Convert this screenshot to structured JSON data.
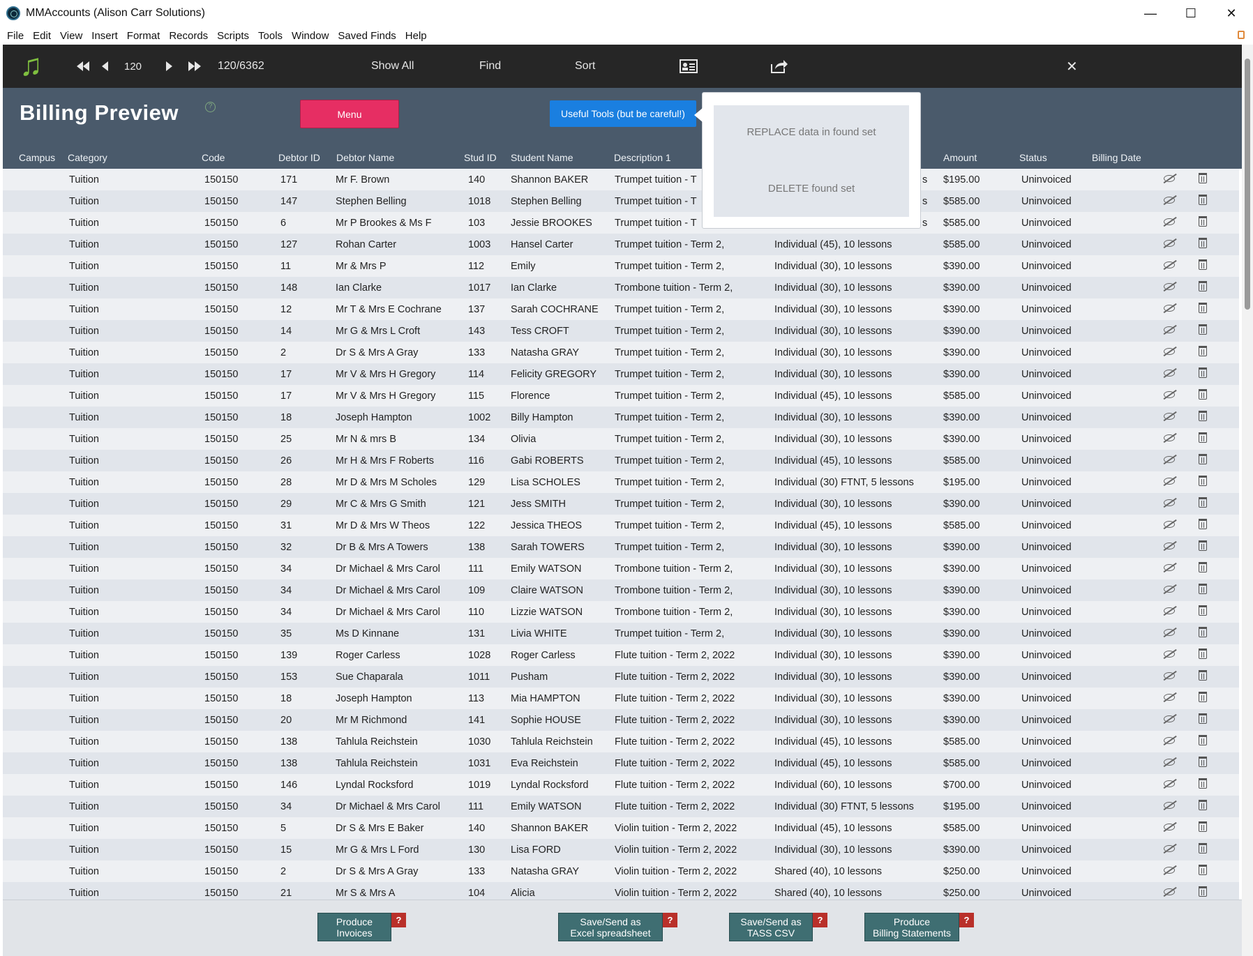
{
  "window": {
    "title": "MMAccounts (Alison Carr Solutions)",
    "minimize": "—",
    "maximize": "☐",
    "close": "✕"
  },
  "menu": [
    "File",
    "Edit",
    "View",
    "Insert",
    "Format",
    "Records",
    "Scripts",
    "Tools",
    "Window",
    "Saved Finds",
    "Help"
  ],
  "toolbar": {
    "record_number": "120",
    "record_count": "120/6362",
    "show_all": "Show All",
    "find": "Find",
    "sort": "Sort"
  },
  "header": {
    "title": "Billing Preview",
    "help": "?",
    "menu_button": "Menu",
    "tools_button": "Useful Tools (but be careful!)",
    "columns": [
      "Campus",
      "Category",
      "Code",
      "Debtor ID",
      "Debtor Name",
      "Stud ID",
      "Student Name",
      "Description 1",
      "Amount",
      "Status",
      "Billing Date"
    ]
  },
  "popover": {
    "replace": "REPLACE data in found set",
    "delete": "DELETE found set"
  },
  "rows": [
    {
      "category": "Tuition",
      "code": "150150",
      "debtor_id": "171",
      "debtor": "Mr F. Brown",
      "stud_id": "140",
      "student": "Shannon BAKER",
      "desc1": "Trumpet tuition - T",
      "desc2": "",
      "amount": "$195.00",
      "status": "Uninvoiced"
    },
    {
      "category": "Tuition",
      "code": "150150",
      "debtor_id": "147",
      "debtor": "Stephen Belling",
      "stud_id": "1018",
      "student": "Stephen Belling",
      "desc1": "Trumpet tuition - T",
      "desc2": "",
      "amount": "$585.00",
      "status": "Uninvoiced"
    },
    {
      "category": "Tuition",
      "code": "150150",
      "debtor_id": "6",
      "debtor": "Mr P Brookes & Ms F",
      "stud_id": "103",
      "student": "Jessie BROOKES",
      "desc1": "Trumpet tuition - T",
      "desc2": "",
      "amount": "$585.00",
      "status": "Uninvoiced"
    },
    {
      "category": "Tuition",
      "code": "150150",
      "debtor_id": "127",
      "debtor": "Rohan Carter",
      "stud_id": "1003",
      "student": "Hansel Carter",
      "desc1": "Trumpet tuition - Term 2,",
      "desc2": "Individual (45), 10 lessons",
      "amount": "$585.00",
      "status": "Uninvoiced"
    },
    {
      "category": "Tuition",
      "code": "150150",
      "debtor_id": "11",
      "debtor": "Mr & Mrs P",
      "stud_id": "112",
      "student": "Emily",
      "desc1": "Trumpet tuition - Term 2,",
      "desc2": "Individual (30), 10 lessons",
      "amount": "$390.00",
      "status": "Uninvoiced"
    },
    {
      "category": "Tuition",
      "code": "150150",
      "debtor_id": "148",
      "debtor": "Ian Clarke",
      "stud_id": "1017",
      "student": "Ian Clarke",
      "desc1": "Trombone tuition - Term 2,",
      "desc2": "Individual (30), 10 lessons",
      "amount": "$390.00",
      "status": "Uninvoiced"
    },
    {
      "category": "Tuition",
      "code": "150150",
      "debtor_id": "12",
      "debtor": "Mr T & Mrs E Cochrane",
      "stud_id": "137",
      "student": "Sarah COCHRANE",
      "desc1": "Trumpet tuition - Term 2,",
      "desc2": "Individual (30), 10 lessons",
      "amount": "$390.00",
      "status": "Uninvoiced"
    },
    {
      "category": "Tuition",
      "code": "150150",
      "debtor_id": "14",
      "debtor": "Mr G & Mrs L Croft",
      "stud_id": "143",
      "student": "Tess CROFT",
      "desc1": "Trumpet tuition - Term 2,",
      "desc2": "Individual (30), 10 lessons",
      "amount": "$390.00",
      "status": "Uninvoiced"
    },
    {
      "category": "Tuition",
      "code": "150150",
      "debtor_id": "2",
      "debtor": "Dr S & Mrs A Gray",
      "stud_id": "133",
      "student": "Natasha GRAY",
      "desc1": "Trumpet tuition - Term 2,",
      "desc2": "Individual (30), 10 lessons",
      "amount": "$390.00",
      "status": "Uninvoiced"
    },
    {
      "category": "Tuition",
      "code": "150150",
      "debtor_id": "17",
      "debtor": "Mr V & Mrs H Gregory",
      "stud_id": "114",
      "student": "Felicity GREGORY",
      "desc1": "Trumpet tuition - Term 2,",
      "desc2": "Individual (30), 10 lessons",
      "amount": "$390.00",
      "status": "Uninvoiced"
    },
    {
      "category": "Tuition",
      "code": "150150",
      "debtor_id": "17",
      "debtor": "Mr V & Mrs H Gregory",
      "stud_id": "115",
      "student": "Florence",
      "desc1": "Trumpet tuition - Term 2,",
      "desc2": "Individual (45), 10 lessons",
      "amount": "$585.00",
      "status": "Uninvoiced"
    },
    {
      "category": "Tuition",
      "code": "150150",
      "debtor_id": "18",
      "debtor": "Joseph Hampton",
      "stud_id": "1002",
      "student": "Billy Hampton",
      "desc1": "Trumpet tuition - Term 2,",
      "desc2": "Individual (30), 10 lessons",
      "amount": "$390.00",
      "status": "Uninvoiced"
    },
    {
      "category": "Tuition",
      "code": "150150",
      "debtor_id": "25",
      "debtor": "Mr N & mrs B",
      "stud_id": "134",
      "student": "Olivia",
      "desc1": "Trumpet tuition - Term 2,",
      "desc2": "Individual (30), 10 lessons",
      "amount": "$390.00",
      "status": "Uninvoiced"
    },
    {
      "category": "Tuition",
      "code": "150150",
      "debtor_id": "26",
      "debtor": "Mr H & Mrs F Roberts",
      "stud_id": "116",
      "student": "Gabi ROBERTS",
      "desc1": "Trumpet tuition - Term 2,",
      "desc2": "Individual (45), 10 lessons",
      "amount": "$585.00",
      "status": "Uninvoiced"
    },
    {
      "category": "Tuition",
      "code": "150150",
      "debtor_id": "28",
      "debtor": "Mr D & Mrs M Scholes",
      "stud_id": "129",
      "student": "Lisa SCHOLES",
      "desc1": "Trumpet tuition - Term 2,",
      "desc2": "Individual (30) FTNT, 5 lessons",
      "amount": "$195.00",
      "status": "Uninvoiced"
    },
    {
      "category": "Tuition",
      "code": "150150",
      "debtor_id": "29",
      "debtor": "Mr C & Mrs G Smith",
      "stud_id": "121",
      "student": "Jess SMITH",
      "desc1": "Trumpet tuition - Term 2,",
      "desc2": "Individual (30), 10 lessons",
      "amount": "$390.00",
      "status": "Uninvoiced"
    },
    {
      "category": "Tuition",
      "code": "150150",
      "debtor_id": "31",
      "debtor": "Mr D & Mrs W Theos",
      "stud_id": "122",
      "student": "Jessica THEOS",
      "desc1": "Trumpet tuition - Term 2,",
      "desc2": "Individual (45), 10 lessons",
      "amount": "$585.00",
      "status": "Uninvoiced"
    },
    {
      "category": "Tuition",
      "code": "150150",
      "debtor_id": "32",
      "debtor": "Dr B & Mrs A Towers",
      "stud_id": "138",
      "student": "Sarah TOWERS",
      "desc1": "Trumpet tuition - Term 2,",
      "desc2": "Individual (30), 10 lessons",
      "amount": "$390.00",
      "status": "Uninvoiced"
    },
    {
      "category": "Tuition",
      "code": "150150",
      "debtor_id": "34",
      "debtor": "Dr Michael & Mrs Carol",
      "stud_id": "111",
      "student": "Emily WATSON",
      "desc1": "Trombone tuition - Term 2,",
      "desc2": "Individual (30), 10 lessons",
      "amount": "$390.00",
      "status": "Uninvoiced"
    },
    {
      "category": "Tuition",
      "code": "150150",
      "debtor_id": "34",
      "debtor": "Dr Michael & Mrs Carol",
      "stud_id": "109",
      "student": "Claire WATSON",
      "desc1": "Trombone tuition - Term 2,",
      "desc2": "Individual (30), 10 lessons",
      "amount": "$390.00",
      "status": "Uninvoiced"
    },
    {
      "category": "Tuition",
      "code": "150150",
      "debtor_id": "34",
      "debtor": "Dr Michael & Mrs Carol",
      "stud_id": "110",
      "student": "Lizzie WATSON",
      "desc1": "Trombone tuition - Term 2,",
      "desc2": "Individual (30), 10 lessons",
      "amount": "$390.00",
      "status": "Uninvoiced"
    },
    {
      "category": "Tuition",
      "code": "150150",
      "debtor_id": "35",
      "debtor": "Ms D Kinnane",
      "stud_id": "131",
      "student": "Livia WHITE",
      "desc1": "Trumpet tuition - Term 2,",
      "desc2": "Individual (30), 10 lessons",
      "amount": "$390.00",
      "status": "Uninvoiced"
    },
    {
      "category": "Tuition",
      "code": "150150",
      "debtor_id": "139",
      "debtor": "Roger Carless",
      "stud_id": "1028",
      "student": "Roger Carless",
      "desc1": "Flute tuition - Term 2, 2022",
      "desc2": "Individual (30), 10 lessons",
      "amount": "$390.00",
      "status": "Uninvoiced"
    },
    {
      "category": "Tuition",
      "code": "150150",
      "debtor_id": "153",
      "debtor": "Sue Chaparala",
      "stud_id": "1011",
      "student": "Pusham",
      "desc1": "Flute tuition - Term 2, 2022",
      "desc2": "Individual (30), 10 lessons",
      "amount": "$390.00",
      "status": "Uninvoiced"
    },
    {
      "category": "Tuition",
      "code": "150150",
      "debtor_id": "18",
      "debtor": "Joseph Hampton",
      "stud_id": "113",
      "student": "Mia HAMPTON",
      "desc1": "Flute tuition - Term 2, 2022",
      "desc2": "Individual (30), 10 lessons",
      "amount": "$390.00",
      "status": "Uninvoiced"
    },
    {
      "category": "Tuition",
      "code": "150150",
      "debtor_id": "20",
      "debtor": "Mr M Richmond",
      "stud_id": "141",
      "student": "Sophie HOUSE",
      "desc1": "Flute tuition - Term 2, 2022",
      "desc2": "Individual (30), 10 lessons",
      "amount": "$390.00",
      "status": "Uninvoiced"
    },
    {
      "category": "Tuition",
      "code": "150150",
      "debtor_id": "138",
      "debtor": "Tahlula Reichstein",
      "stud_id": "1030",
      "student": "Tahlula Reichstein",
      "desc1": "Flute tuition - Term 2, 2022",
      "desc2": "Individual (45), 10 lessons",
      "amount": "$585.00",
      "status": "Uninvoiced"
    },
    {
      "category": "Tuition",
      "code": "150150",
      "debtor_id": "138",
      "debtor": "Tahlula Reichstein",
      "stud_id": "1031",
      "student": "Eva Reichstein",
      "desc1": "Flute tuition - Term 2, 2022",
      "desc2": "Individual (45), 10 lessons",
      "amount": "$585.00",
      "status": "Uninvoiced"
    },
    {
      "category": "Tuition",
      "code": "150150",
      "debtor_id": "146",
      "debtor": "Lyndal Rocksford",
      "stud_id": "1019",
      "student": "Lyndal Rocksford",
      "desc1": "Flute tuition - Term 2, 2022",
      "desc2": "Individual (60), 10 lessons",
      "amount": "$700.00",
      "status": "Uninvoiced"
    },
    {
      "category": "Tuition",
      "code": "150150",
      "debtor_id": "34",
      "debtor": "Dr Michael & Mrs Carol",
      "stud_id": "111",
      "student": "Emily WATSON",
      "desc1": "Flute tuition - Term 2, 2022",
      "desc2": "Individual (30) FTNT, 5 lessons",
      "amount": "$195.00",
      "status": "Uninvoiced"
    },
    {
      "category": "Tuition",
      "code": "150150",
      "debtor_id": "5",
      "debtor": "Dr S & Mrs E Baker",
      "stud_id": "140",
      "student": "Shannon BAKER",
      "desc1": "Violin tuition - Term 2, 2022",
      "desc2": "Individual (45), 10 lessons",
      "amount": "$585.00",
      "status": "Uninvoiced"
    },
    {
      "category": "Tuition",
      "code": "150150",
      "debtor_id": "15",
      "debtor": "Mr G & Mrs L Ford",
      "stud_id": "130",
      "student": "Lisa FORD",
      "desc1": "Violin tuition - Term 2, 2022",
      "desc2": "Individual (30), 10 lessons",
      "amount": "$390.00",
      "status": "Uninvoiced"
    },
    {
      "category": "Tuition",
      "code": "150150",
      "debtor_id": "2",
      "debtor": "Dr S & Mrs A Gray",
      "stud_id": "133",
      "student": "Natasha GRAY",
      "desc1": "Violin tuition - Term 2, 2022",
      "desc2": "Shared (40), 10 lessons",
      "amount": "$250.00",
      "status": "Uninvoiced"
    },
    {
      "category": "Tuition",
      "code": "150150",
      "debtor_id": "21",
      "debtor": "Mr S & Mrs A",
      "stud_id": "104",
      "student": "Alicia",
      "desc1": "Violin tuition - Term 2, 2022",
      "desc2": "Shared (40), 10 lessons",
      "amount": "$250.00",
      "status": "Uninvoiced"
    }
  ],
  "popover_row_suffix": "s",
  "footer": {
    "produce_invoices": [
      "Produce",
      "Invoices"
    ],
    "save_excel": [
      "Save/Send as",
      "Excel spreadsheet"
    ],
    "save_tass": [
      "Save/Send as",
      "TASS CSV"
    ],
    "billing_statements": [
      "Produce",
      "Billing Statements"
    ],
    "help": "?"
  }
}
